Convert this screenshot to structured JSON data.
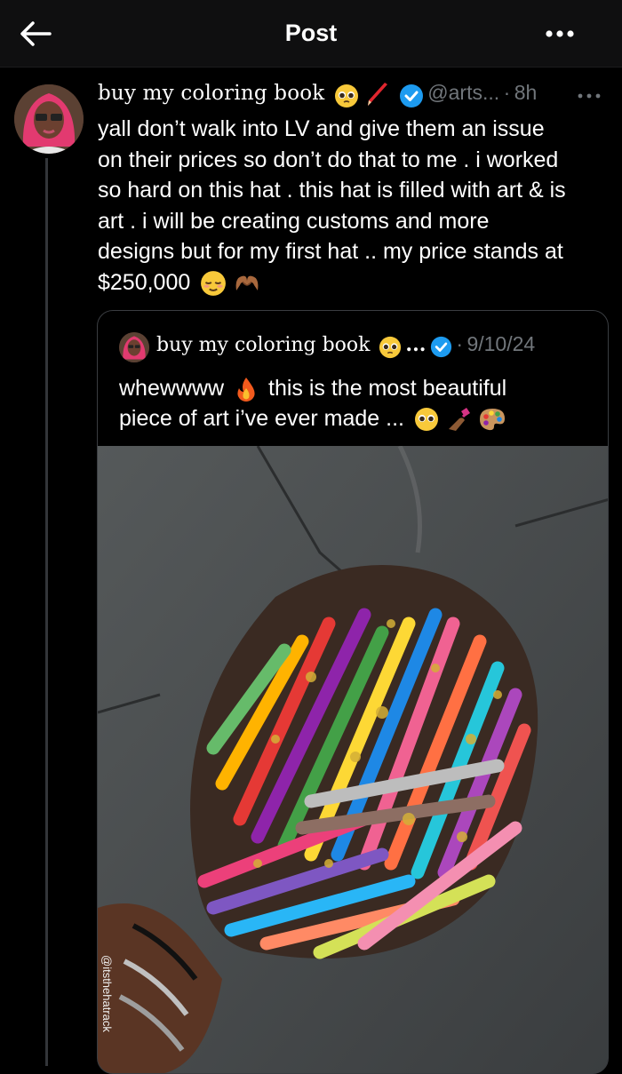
{
  "header": {
    "title": "Post"
  },
  "post": {
    "display_name": "buy my coloring book",
    "handle": "@arts...",
    "separator": "·",
    "time": "8h",
    "lines": [
      "yall don’t walk into LV and give them an issue",
      "on their prices so don’t do that to me . i worked",
      "so hard on this hat . this hat is filled with art & is",
      "art . i will be creating customs and more",
      "designs but for my first hat .. my price stands at",
      "$250,000"
    ]
  },
  "quote": {
    "display_name": "buy my coloring book",
    "ellipsis": "...",
    "separator": "·",
    "date": "9/10/24",
    "line1": "whewwww",
    "line1_rest": "this is the most beautiful",
    "line2": "piece of art i’ve ever made ...",
    "watermark": "@itsthehatrack"
  },
  "colors": {
    "background": "#000000",
    "verified": "#1d9bf0",
    "secondary_text": "#71767b",
    "border": "#3a3d41"
  },
  "icons": [
    "back-arrow-icon",
    "more-dots-icon",
    "verified-badge-icon",
    "pleading-face-emoji",
    "crayon-emoji",
    "relieved-face-emoji",
    "heart-hands-emoji",
    "fire-emoji",
    "nail-polish-emoji",
    "artist-palette-emoji"
  ]
}
